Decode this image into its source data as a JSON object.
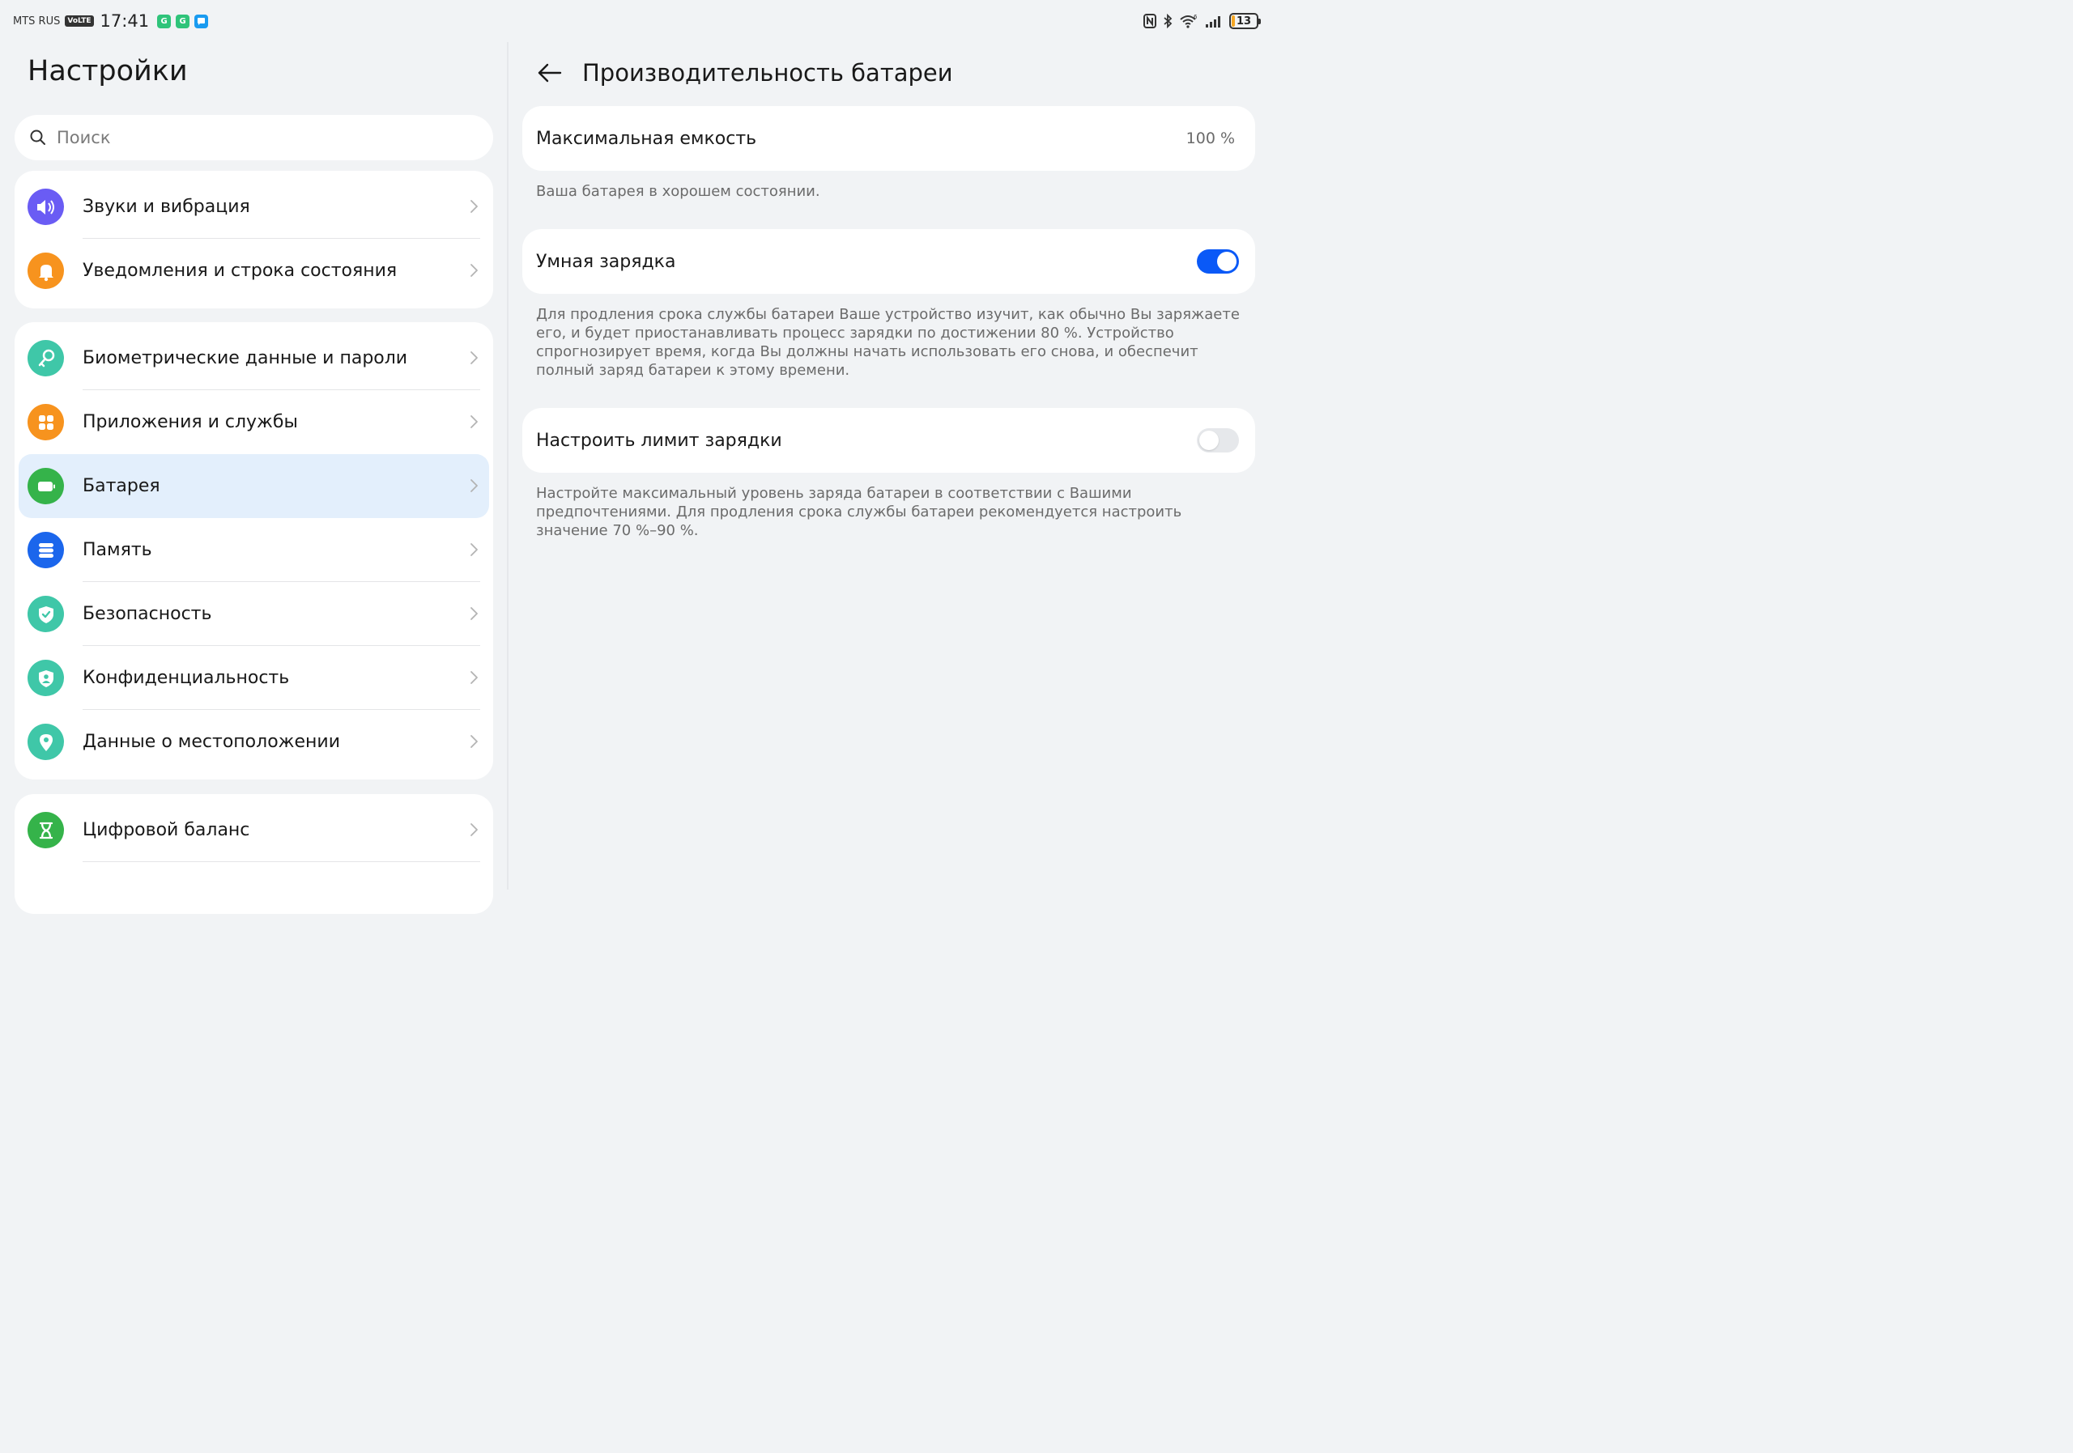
{
  "status_bar": {
    "carrier": "MTS RUS",
    "volte": "VoLTE",
    "time": "17:41",
    "battery_level": "13",
    "battery_fraction": 0.13,
    "battery_color": "#f5a623",
    "notification_icons": [
      "g-app-icon",
      "g-app-icon",
      "chat-app-icon"
    ],
    "system_icons": [
      "nfc-icon",
      "bluetooth-icon",
      "wifi-6-icon",
      "signal-icon"
    ]
  },
  "settings": {
    "title": "Настройки",
    "search_placeholder": "Поиск",
    "groups": [
      {
        "items": [
          {
            "label": "Звуки и вибрация",
            "icon": "speaker-icon",
            "color": "#6a5cf4"
          },
          {
            "label": "Уведомления и строка состояния",
            "icon": "bell-icon",
            "color": "#f7931e"
          }
        ]
      },
      {
        "items": [
          {
            "label": "Биометрические данные и пароли",
            "icon": "key-icon",
            "color": "#3fc7a8"
          },
          {
            "label": "Приложения и службы",
            "icon": "apps-grid-icon",
            "color": "#f7931e"
          },
          {
            "label": "Батарея",
            "icon": "battery-icon",
            "color": "#35b34a",
            "selected": true
          },
          {
            "label": "Память",
            "icon": "storage-icon",
            "color": "#1b66ec"
          },
          {
            "label": "Безопасность",
            "icon": "shield-check-icon",
            "color": "#3fc7a8"
          },
          {
            "label": "Конфиденциальность",
            "icon": "privacy-shield-icon",
            "color": "#3fc7a8"
          },
          {
            "label": "Данные о местоположении",
            "icon": "location-pin-icon",
            "color": "#3fc7a8"
          }
        ]
      },
      {
        "items": [
          {
            "label": "Цифровой баланс",
            "icon": "hourglass-icon",
            "color": "#35b34a"
          }
        ]
      }
    ]
  },
  "battery_performance": {
    "title": "Производительность батареи",
    "max_capacity": {
      "label": "Максимальная емкость",
      "value": "100 %"
    },
    "health_text": "Ваша батарея в хорошем состоянии.",
    "smart_charging": {
      "label": "Умная зарядка",
      "enabled": true,
      "description": "Для продления срока службы батареи Ваше устройство изучит, как обычно Вы заряжаете его, и будет приостанавливать процесс зарядки по достижении 80 %. Устройство спрогнозирует время, когда Вы должны начать использовать его снова, и обеспечит полный заряд батареи к этому времени."
    },
    "charge_limit": {
      "label": "Настроить лимит зарядки",
      "enabled": false,
      "description": "Настройте максимальный уровень заряда батареи в соответствии с Вашими предпочтениями. Для продления срока службы батареи рекомендуется настроить значение 70 %–90 %."
    },
    "accent_color": "#0a59f7"
  }
}
